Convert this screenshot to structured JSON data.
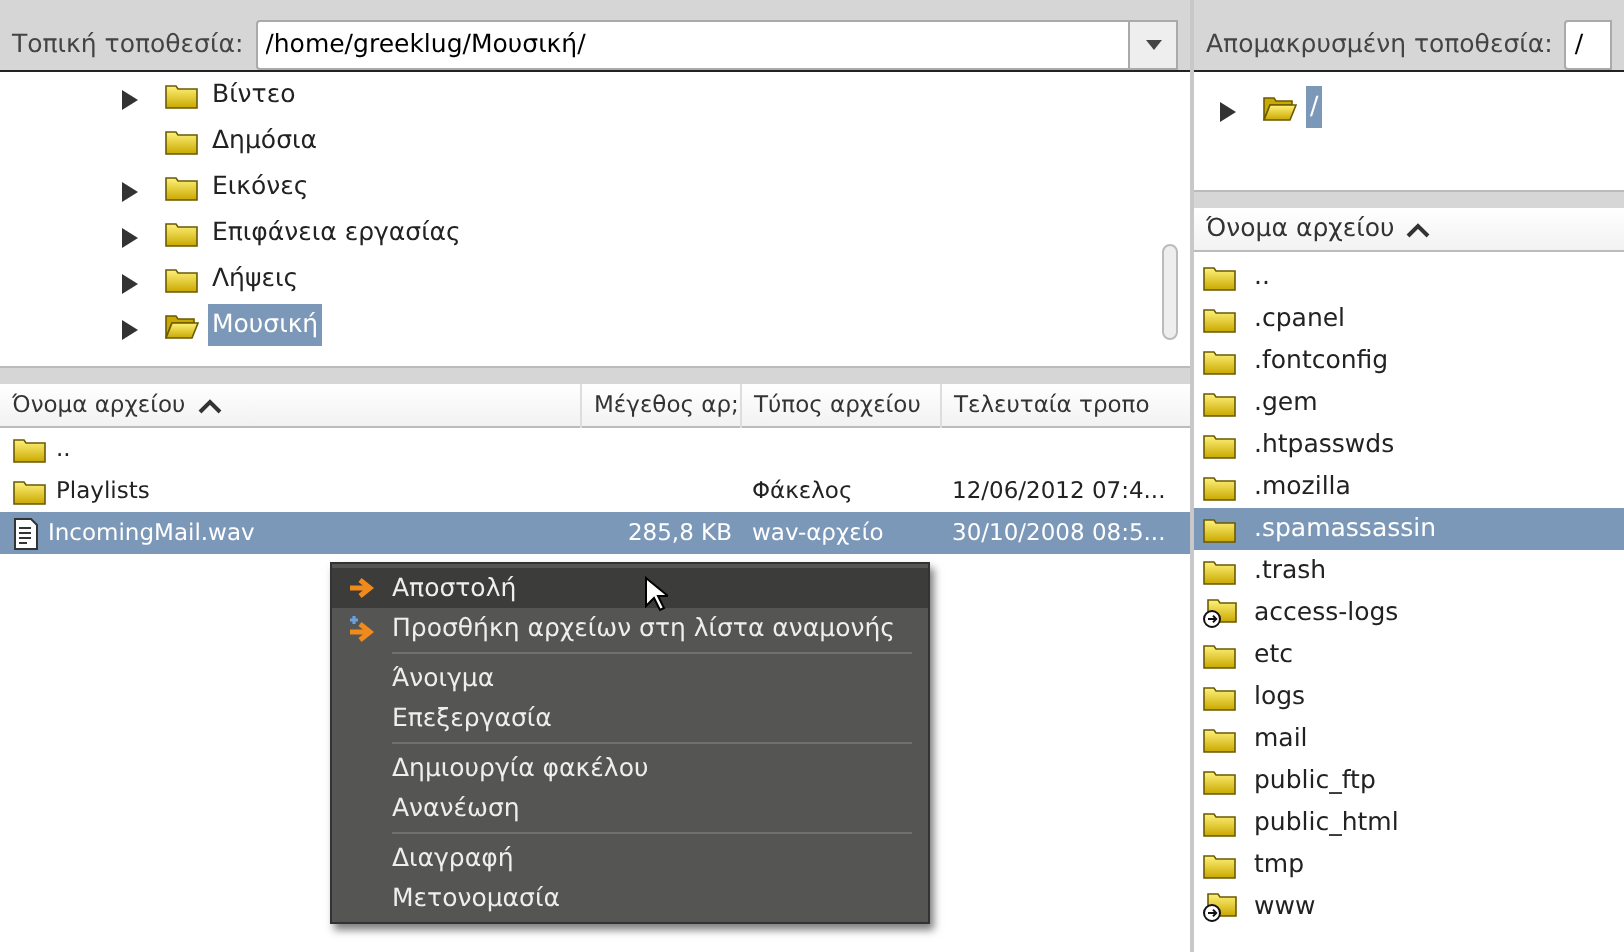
{
  "local": {
    "label": "Τοπική τοποθεσία:",
    "path": "/home/greeklug/Μουσική/",
    "tree": [
      {
        "name": "Βίντεο",
        "expander": true,
        "open": false,
        "selected": false
      },
      {
        "name": "Δημόσια",
        "expander": false,
        "open": false,
        "selected": false
      },
      {
        "name": "Εικόνες",
        "expander": true,
        "open": false,
        "selected": false
      },
      {
        "name": "Επιφάνεια εργασίας",
        "expander": true,
        "open": false,
        "selected": false
      },
      {
        "name": "Λήψεις",
        "expander": true,
        "open": false,
        "selected": false
      },
      {
        "name": "Μουσική",
        "expander": true,
        "open": true,
        "selected": true
      }
    ],
    "columns": [
      "Όνομα αρχείου",
      "Μέγεθος αρ;",
      "Τύπος αρχείου",
      "Τελευταία τροπο"
    ],
    "rows": [
      {
        "kind": "folder",
        "cells": [
          "..",
          "",
          "",
          ""
        ],
        "selected": false
      },
      {
        "kind": "folder",
        "cells": [
          "Playlists",
          "",
          "Φάκελος",
          "12/06/2012 07:4..."
        ],
        "selected": false
      },
      {
        "kind": "file",
        "cells": [
          "IncomingMail.wav",
          "285,8 KB",
          "wav-αρχείο",
          "30/10/2008 08:5..."
        ],
        "selected": true
      }
    ]
  },
  "remote": {
    "label": "Απομακρυσμένη τοποθεσία:",
    "path": "/",
    "tree": [
      {
        "name": "/",
        "expander": true,
        "open": true,
        "selected": true
      }
    ],
    "columns": [
      "Όνομα αρχείου"
    ],
    "rows": [
      {
        "kind": "folder",
        "name": "..",
        "selected": false
      },
      {
        "kind": "folder",
        "name": ".cpanel",
        "selected": false
      },
      {
        "kind": "folder",
        "name": ".fontconfig",
        "selected": false
      },
      {
        "kind": "folder",
        "name": ".gem",
        "selected": false
      },
      {
        "kind": "folder",
        "name": ".htpasswds",
        "selected": false
      },
      {
        "kind": "folder",
        "name": ".mozilla",
        "selected": false
      },
      {
        "kind": "folder",
        "name": ".spamassassin",
        "selected": true
      },
      {
        "kind": "folder",
        "name": ".trash",
        "selected": false
      },
      {
        "kind": "link",
        "name": "access-logs",
        "selected": false
      },
      {
        "kind": "folder",
        "name": "etc",
        "selected": false
      },
      {
        "kind": "folder",
        "name": "logs",
        "selected": false
      },
      {
        "kind": "folder",
        "name": "mail",
        "selected": false
      },
      {
        "kind": "folder",
        "name": "public_ftp",
        "selected": false
      },
      {
        "kind": "folder",
        "name": "public_html",
        "selected": false
      },
      {
        "kind": "folder",
        "name": "tmp",
        "selected": false
      },
      {
        "kind": "link",
        "name": "www",
        "selected": false
      }
    ]
  },
  "context_menu": [
    {
      "kind": "send",
      "label": "Αποστολή",
      "selected": true
    },
    {
      "kind": "enqueue",
      "label": "Προσθήκη αρχείων στη λίστα αναμονής",
      "selected": false
    },
    {
      "kind": "separator"
    },
    {
      "kind": "item",
      "label": "Άνοιγμα",
      "selected": false
    },
    {
      "kind": "item",
      "label": "Επεξεργασία",
      "selected": false
    },
    {
      "kind": "separator"
    },
    {
      "kind": "item",
      "label": "Δημιουργία φακέλου",
      "selected": false
    },
    {
      "kind": "item",
      "label": "Ανανέωση",
      "selected": false
    },
    {
      "kind": "separator"
    },
    {
      "kind": "item",
      "label": "Διαγραφή",
      "selected": false
    },
    {
      "kind": "item",
      "label": "Μετονομασία",
      "selected": false
    }
  ]
}
